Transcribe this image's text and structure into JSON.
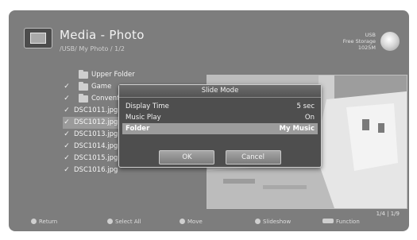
{
  "header": {
    "title": "Media - Photo",
    "path": "/USB/ My Photo / 1/2",
    "usb_line1": "USB",
    "usb_line2": "Free Storage",
    "usb_line3": "1025M"
  },
  "file_list": [
    {
      "text": "Upper Folder",
      "checked": false,
      "folder": true
    },
    {
      "text": "Game",
      "checked": true,
      "folder": true
    },
    {
      "text": "Convention",
      "checked": true,
      "folder": true
    },
    {
      "text": "DSC1011.jpg",
      "checked": true,
      "folder": false
    },
    {
      "text": "DSC1012.jpg",
      "checked": true,
      "folder": false,
      "selected": true
    },
    {
      "text": "DSC1013.jpg",
      "checked": true,
      "folder": false
    },
    {
      "text": "DSC1014.jpg",
      "checked": true,
      "folder": false
    },
    {
      "text": "DSC1015.jpg",
      "checked": true,
      "folder": false
    },
    {
      "text": "DSC1016.jpg",
      "checked": true,
      "folder": false
    }
  ],
  "dialog": {
    "title": "Slide Mode",
    "options": [
      {
        "label": "Display Time",
        "value": "5 sec"
      },
      {
        "label": "Music Play",
        "value": "On"
      },
      {
        "label": "Folder",
        "value": "My Music"
      }
    ],
    "ok_label": "OK",
    "cancel_label": "Cancel"
  },
  "footer": {
    "pager": "1/4 | 1/9",
    "hints": [
      {
        "label": "Return",
        "icon": "button-icon"
      },
      {
        "label": "Select All",
        "icon": "button-icon"
      },
      {
        "label": "Move",
        "icon": "button-icon"
      },
      {
        "label": "Slideshow",
        "icon": "button-icon"
      },
      {
        "label": "Function",
        "icon": "rect-button-icon"
      }
    ]
  },
  "colors": {
    "screen_bg": "#7d7d7d",
    "dialog_bg": "#4e4e4e",
    "highlight": "#9c9c9c"
  }
}
